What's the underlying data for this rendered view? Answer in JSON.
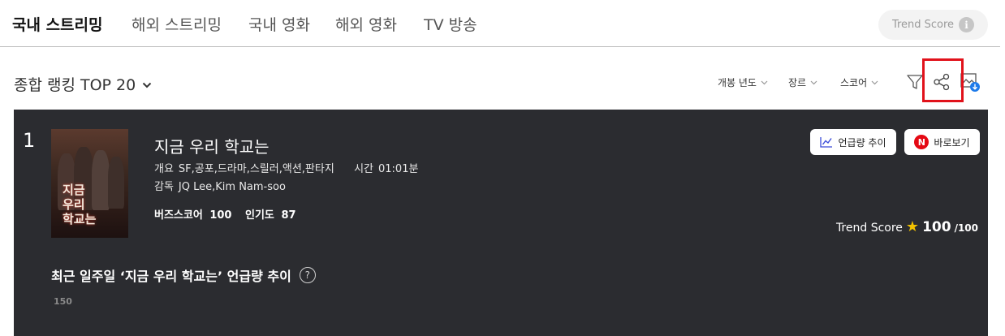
{
  "nav": {
    "tabs": [
      {
        "label": "국내 스트리밍",
        "active": true
      },
      {
        "label": "해외 스트리밍",
        "active": false
      },
      {
        "label": "국내 영화",
        "active": false
      },
      {
        "label": "해외 영화",
        "active": false
      },
      {
        "label": "TV 방송",
        "active": false
      }
    ],
    "trend_score_label": "Trend Score",
    "info_glyph": "i"
  },
  "ranking": {
    "title": "종합 랭킹 TOP 20",
    "filters": [
      {
        "label": "개봉 년도"
      },
      {
        "label": "장르"
      },
      {
        "label": "스코어"
      }
    ],
    "tools": [
      "filter-icon",
      "share-icon",
      "image-download-icon"
    ],
    "highlight_color": "#e1121b"
  },
  "item": {
    "rank": "1",
    "title": "지금 우리 학교는",
    "poster_text": [
      "지금",
      "우리",
      "학교는"
    ],
    "overview_label": "개요",
    "genres": "SF,공포,드라마,스릴러,액션,판타지",
    "time_label": "시간",
    "runtime": "01:01분",
    "director_label": "감독",
    "directors": "JQ Lee,Kim Nam-soo",
    "buzz_label": "버즈스코어",
    "buzz_score": "100",
    "popularity_label": "인기도",
    "popularity": "87",
    "mention_trend_button": "언급량 추이",
    "watch_button": "바로보기",
    "watch_badge": "N",
    "trend_score_label": "Trend Score",
    "trend_score": "100",
    "trend_score_max": "/100"
  },
  "weekly": {
    "title": "최근 일주일 ‘지금 우리 학교는’ 언급량 추이",
    "help_glyph": "?",
    "y_tick": "150"
  },
  "colors": {
    "card_bg": "#2b2c30",
    "accent_red": "#e1121b",
    "netflix_red": "#e50914",
    "star": "#f2c200"
  }
}
